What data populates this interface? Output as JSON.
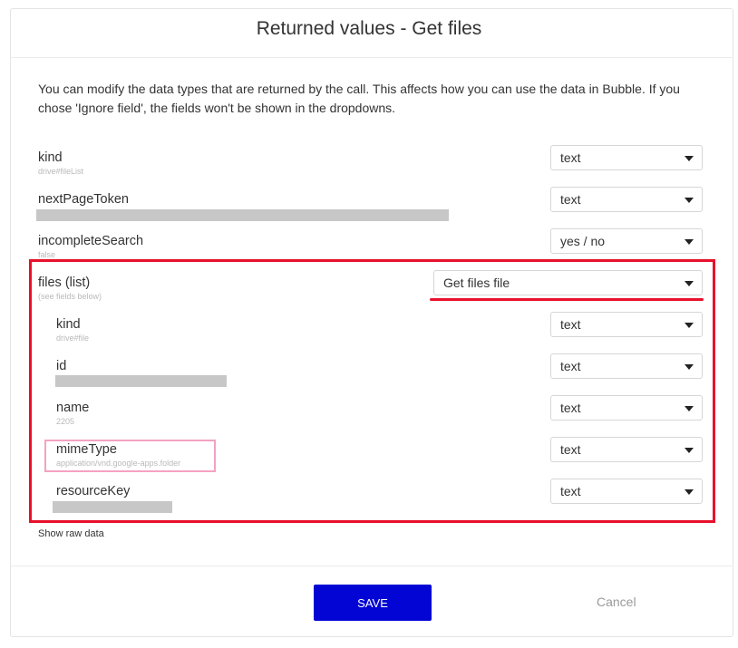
{
  "dialog": {
    "title": "Returned values - Get files",
    "description": "You can modify the data types that are returned by the call. This affects how you can use the data in Bubble. If you chose 'Ignore field', the fields won't be shown in the dropdowns."
  },
  "fields": {
    "kind": {
      "name": "kind",
      "sample": "drive#fileList",
      "type": "text"
    },
    "nextPageToken": {
      "name": "nextPageToken",
      "type": "text"
    },
    "incompleteSearch": {
      "name": "incompleteSearch",
      "sample": "false",
      "type": "yes / no"
    },
    "files": {
      "name": "files (list)",
      "sample": "(see fields below)",
      "type": "Get files file"
    }
  },
  "subfields": {
    "kind": {
      "name": "kind",
      "sample": "drive#file",
      "type": "text"
    },
    "id": {
      "name": "id",
      "type": "text"
    },
    "name": {
      "name": "name",
      "sample": "2205",
      "type": "text"
    },
    "mimeType": {
      "name": "mimeType",
      "sample": "application/vnd.google-apps.folder",
      "type": "text"
    },
    "resourceKey": {
      "name": "resourceKey",
      "type": "text"
    }
  },
  "footer": {
    "show_raw": "Show raw data",
    "save_label": "SAVE",
    "cancel_label": "Cancel"
  },
  "colors": {
    "primary_button": "#0205d3",
    "annotation_red": "#e8102c",
    "annotation_pink": "#f3a2c2"
  }
}
